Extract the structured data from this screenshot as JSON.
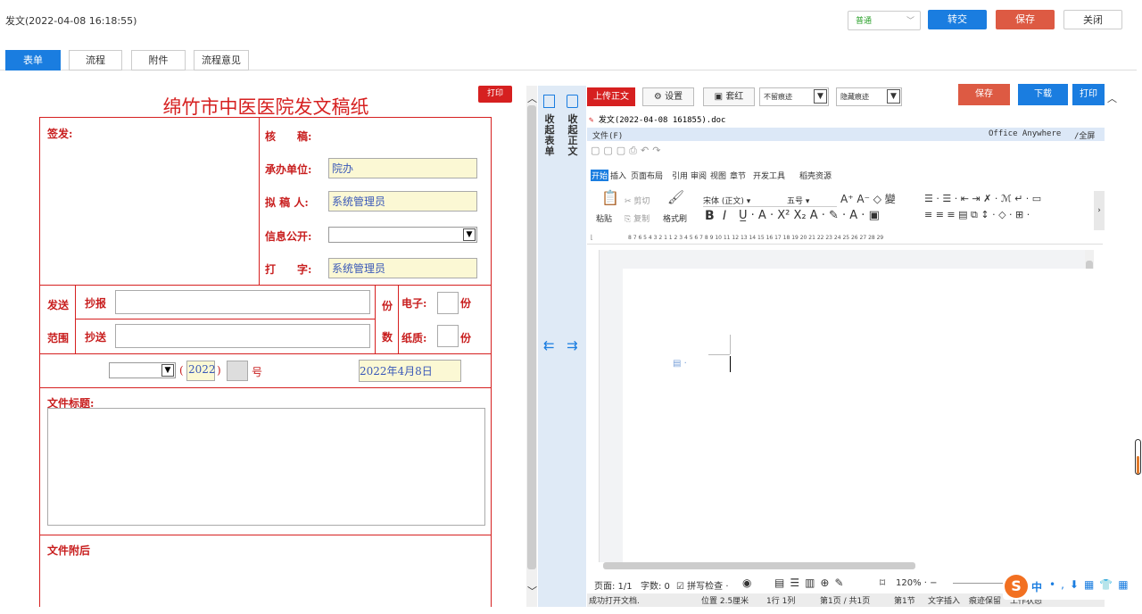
{
  "window": {
    "title": "发文(2022-04-08 16:18:55)"
  },
  "topbar": {
    "mode_select": "普通",
    "transfer": "转交",
    "save": "保存",
    "close": "关闭"
  },
  "tabs": [
    "表单",
    "流程",
    "附件",
    "流程意见"
  ],
  "form": {
    "title": "绵竹市中医医院发文稿纸",
    "print": "打印",
    "sign_label": "签发:",
    "review_label": "核　　稿:",
    "org_label": "承办单位:",
    "org_value": "院办",
    "drafter_label": "拟 稿 人:",
    "drafter_value": "系统管理员",
    "public_label": "信息公开:",
    "typist_label": "打　　字:",
    "typist_value": "系统管理员",
    "send_label_1": "发送",
    "send_label_2": "范围",
    "cc_label": "抄报",
    "bcc_label": "抄送",
    "copies_label_1": "份",
    "copies_label_2": "数",
    "electronic_label": "电子:",
    "paper_label": "纸质:",
    "unit": "份",
    "year_open": "(",
    "year": "2022",
    "year_close": ")",
    "number_suffix": "号",
    "date": "2022年4月8日",
    "doc_title_label": "文件标题:",
    "attachment_label": "文件附后"
  },
  "side_nav": {
    "collapse_form": "收起表单",
    "collapse_body": "收起正文"
  },
  "office": {
    "toolbar": {
      "upload": "上传正文",
      "settings": "设置",
      "red_header": "套红",
      "keep_trace": "不留痕迹",
      "hide_trace": "隐藏痕迹",
      "save": "保存",
      "download": "下载",
      "print": "打印"
    },
    "file_name": "发文(2022-04-08 161855).doc",
    "menu_file": "文件(F)",
    "brand": "Office Anywhere",
    "fullscreen": "全屏",
    "ribbon_tabs": [
      "开始",
      "插入",
      "页面布局",
      "引用",
      "审阅",
      "视图",
      "章节",
      "开发工具",
      "稻壳资源"
    ],
    "paste": "粘贴",
    "cut": "剪切",
    "copy": "复制",
    "format_painter": "格式刷",
    "font_name": "宋体 (正文)",
    "font_size": "五号",
    "ruler_text": "8 7 6 5 4 3 2 1   1 2 3 4 5 6 7 8 9 10 11 12 13 14 15 16 17 18 19 20 21 22 23 24 25 26 27 28 29",
    "status": {
      "page": "页面: 1/1",
      "words": "字数: 0",
      "spell": "拼写检查",
      "zoom": "120%"
    },
    "status2": [
      "成功打开文档.",
      "位置 2.5厘米",
      "1行 1列",
      "第1页 / 共1页",
      "第1节",
      "文字插入",
      "痕迹保留",
      "工作状态"
    ]
  },
  "ime": {
    "lang": "中"
  },
  "colors": {
    "accent_blue": "#1a7de0",
    "save_red": "#dd5a43",
    "form_red": "#d62020",
    "field_yellow": "#fbf8d4"
  }
}
